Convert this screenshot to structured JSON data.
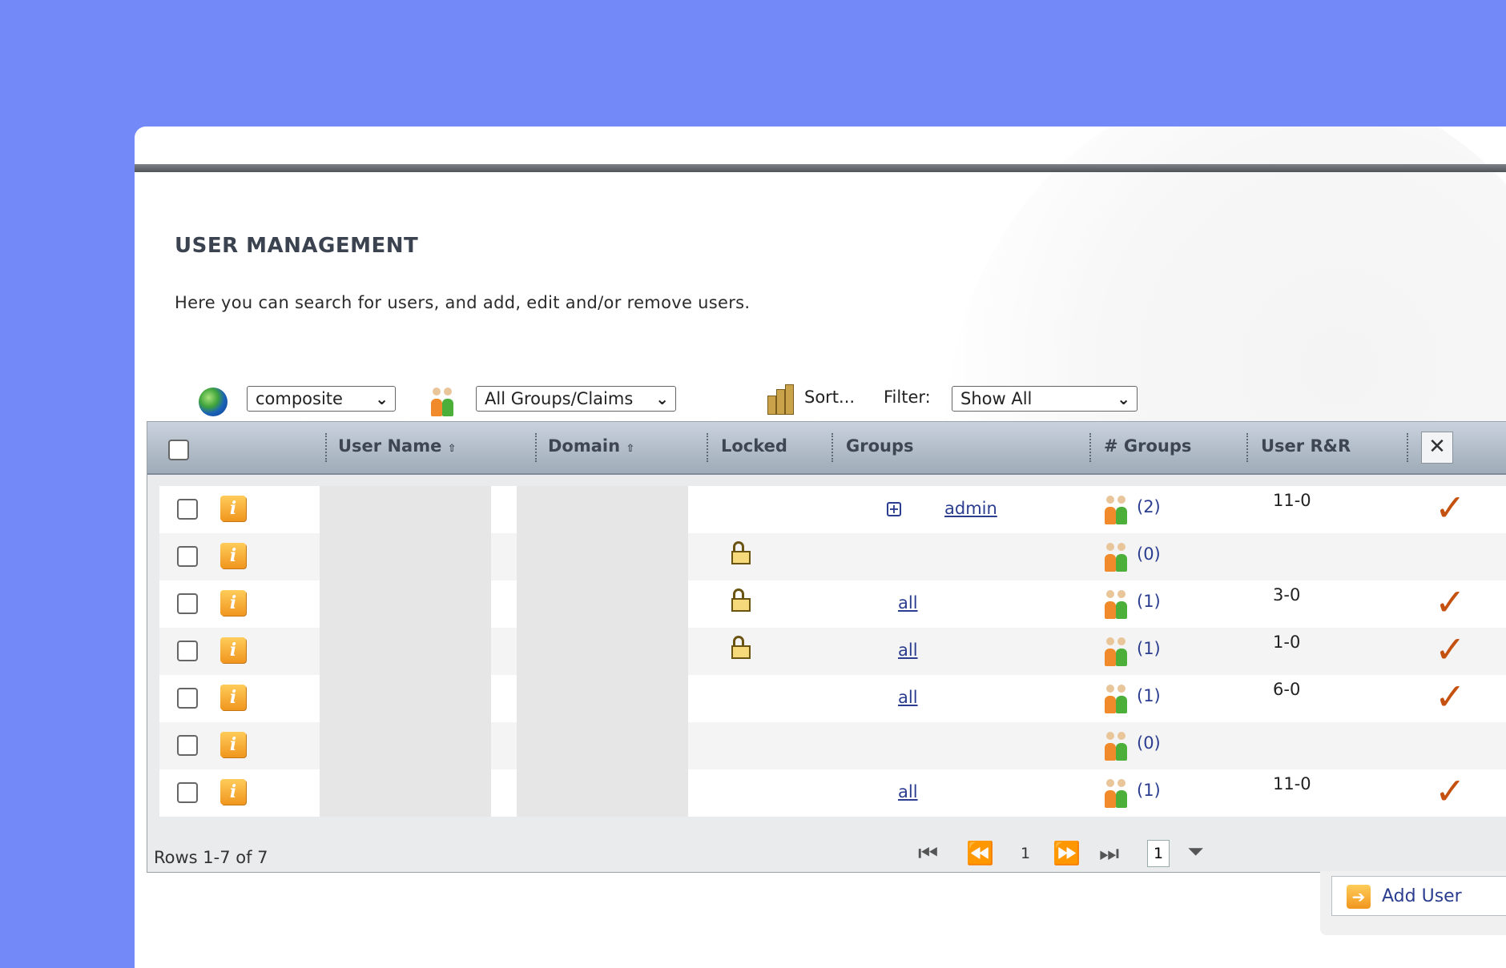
{
  "page": {
    "title": "USER MANAGEMENT",
    "description": "Here you can search for users, and add, edit and/or remove users."
  },
  "toolbar": {
    "domain_select": "composite",
    "group_select": "All Groups/Claims",
    "sort_label": "Sort...",
    "filter_label": "Filter:",
    "filter_select": "Show All"
  },
  "table": {
    "headers": {
      "user_name": "User Name",
      "domain": "Domain",
      "locked": "Locked",
      "groups": "Groups",
      "num_groups": "# Groups",
      "user_rr": "User R&R"
    },
    "rows": [
      {
        "locked": false,
        "groups": "admin",
        "groups_expandable": true,
        "count": "(2)",
        "rr": "11-0",
        "checked": true
      },
      {
        "locked": true,
        "groups": "",
        "groups_expandable": false,
        "count": "(0)",
        "rr": "",
        "checked": false
      },
      {
        "locked": true,
        "groups": "all",
        "groups_expandable": false,
        "count": "(1)",
        "rr": "3-0",
        "checked": true
      },
      {
        "locked": true,
        "groups": "all",
        "groups_expandable": false,
        "count": "(1)",
        "rr": "1-0",
        "checked": true
      },
      {
        "locked": false,
        "groups": "all",
        "groups_expandable": false,
        "count": "(1)",
        "rr": "6-0",
        "checked": true
      },
      {
        "locked": false,
        "groups": "",
        "groups_expandable": false,
        "count": "(0)",
        "rr": "",
        "checked": false
      },
      {
        "locked": false,
        "groups": "all",
        "groups_expandable": false,
        "count": "(1)",
        "rr": "11-0",
        "checked": true
      }
    ],
    "footer": {
      "rows_text": "Rows 1-7 of 7",
      "page_number": "1",
      "page_box": "1"
    }
  },
  "actions": {
    "add_user": "Add User"
  },
  "colors": {
    "background": "#7289f7",
    "link": "#2b3d8f",
    "check": "#c4510f",
    "info": "#f0961e"
  },
  "icons": [
    "globe-icon",
    "people-icon",
    "sort-icon",
    "info-icon",
    "lock-icon",
    "expand-icon",
    "check-icon",
    "tools-icon",
    "first-page-icon",
    "prev-page-icon",
    "next-page-icon",
    "last-page-icon",
    "filter-icon",
    "add-user-icon"
  ]
}
